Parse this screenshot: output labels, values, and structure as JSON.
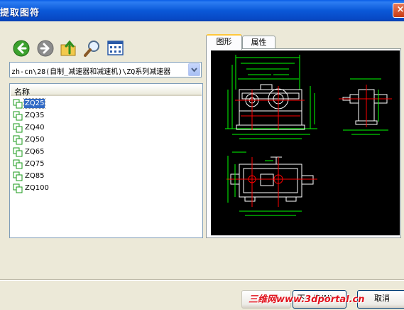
{
  "window": {
    "title": "提取图符",
    "close_glyph": "×"
  },
  "toolbar": {
    "buttons": [
      {
        "name": "back",
        "icon": "green-left-arrow-icon"
      },
      {
        "name": "forward",
        "icon": "gray-right-arrow-icon"
      },
      {
        "name": "up-folder",
        "icon": "folder-up-icon"
      },
      {
        "name": "search",
        "icon": "magnifier-icon"
      },
      {
        "name": "view",
        "icon": "grid-view-icon"
      }
    ]
  },
  "path": {
    "value": "zh-cn\\28(自制_减速器和减速机)\\ZQ系列减速器"
  },
  "list": {
    "header": "名称",
    "items": [
      {
        "label": "ZQ25",
        "selected": true
      },
      {
        "label": "ZQ35",
        "selected": false
      },
      {
        "label": "ZQ40",
        "selected": false
      },
      {
        "label": "ZQ50",
        "selected": false
      },
      {
        "label": "ZQ65",
        "selected": false
      },
      {
        "label": "ZQ75",
        "selected": false
      },
      {
        "label": "ZQ85",
        "selected": false
      },
      {
        "label": "ZQ100",
        "selected": false
      }
    ]
  },
  "tabs": [
    {
      "label": "图形",
      "active": true
    },
    {
      "label": "属性",
      "active": false
    }
  ],
  "footer": {
    "next_label": "下一步(N) >",
    "cancel_label": "取消",
    "watermark": "三维网www.3dportal.cn"
  },
  "colors": {
    "accent": "#316ac5",
    "drawing_white": "#ffffff",
    "drawing_green": "#00ff00",
    "drawing_red": "#ff0000"
  }
}
